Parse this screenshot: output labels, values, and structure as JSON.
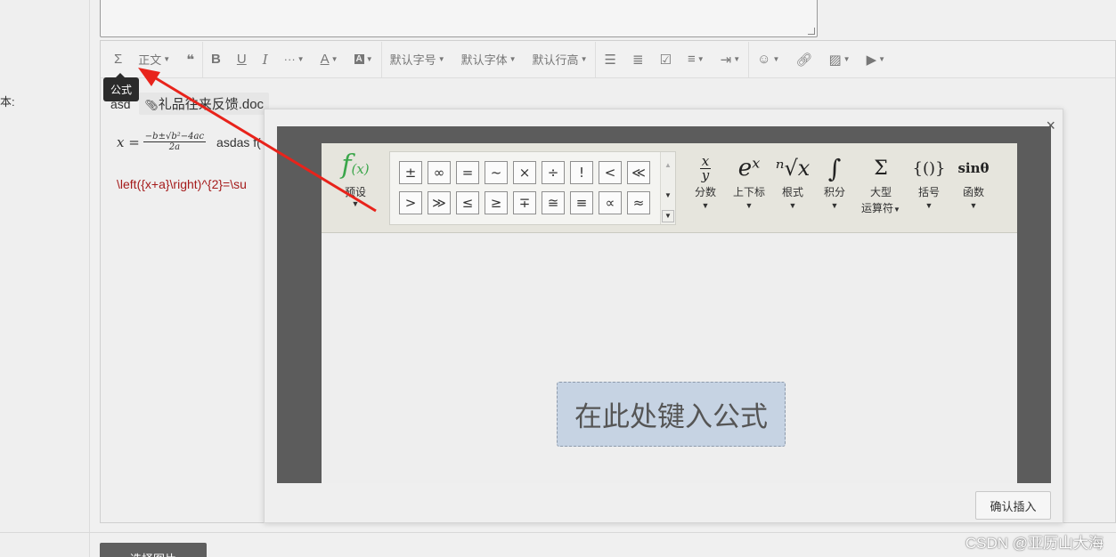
{
  "form": {
    "field_label": "本:",
    "select_image_button": "选择图片"
  },
  "toolbar": {
    "formula_icon": "Σ",
    "paragraph": "正文",
    "quote_icon": "❝",
    "bold": "B",
    "underline": "U",
    "italic": "I",
    "more": "···",
    "font_color": "A",
    "bg_color": "A",
    "font_size": "默认字号",
    "font_family": "默认字体",
    "line_height": "默认行高",
    "icons": [
      "bulleted-list-icon",
      "numbered-list-icon",
      "todo-list-icon",
      "align-icon",
      "indent-icon",
      "emoji-icon",
      "link-icon",
      "image-icon",
      "video-icon"
    ]
  },
  "tooltip": "公式",
  "content": {
    "text_prefix": "asd",
    "attachment": "礼品往来反馈.doc",
    "formula_x": "x =",
    "formula_numerator": "−b±√b²−4ac",
    "formula_denominator": "2a",
    "formula_suffix": "asdas f(",
    "latex_text": "\\left({x+a}\\right)^{2}=\\su"
  },
  "dialog": {
    "close": "×",
    "preset_label": "预设",
    "symbols": [
      "±",
      "∞",
      "=",
      "~",
      "×",
      "÷",
      "!",
      "<",
      "≪",
      ">",
      "≫",
      "≤",
      "≥",
      "∓",
      "≅",
      "≡",
      "∝",
      "≈"
    ],
    "tools": [
      {
        "glyph_top": "x",
        "glyph_bottom": "y",
        "label": "分数"
      },
      {
        "glyph": "eˣ",
        "label": "上下标"
      },
      {
        "glyph": "ⁿ√x",
        "label": "根式"
      },
      {
        "glyph": "∫",
        "label": "积分"
      },
      {
        "glyph": "Σ",
        "label": "大型",
        "label2": "运算符"
      },
      {
        "glyph": "{()}",
        "label": "括号"
      },
      {
        "glyph": "sinθ",
        "label": "函数"
      }
    ],
    "placeholder": "在此处键入公式",
    "confirm_button": "确认插入"
  },
  "watermark": "CSDN @亚历山大海",
  "colors": {
    "preset_green": "#3aa64a",
    "latex_red": "#a51b1b",
    "annotation_arrow": "#e8231b",
    "placeholder_bg": "#c6d3e3"
  }
}
